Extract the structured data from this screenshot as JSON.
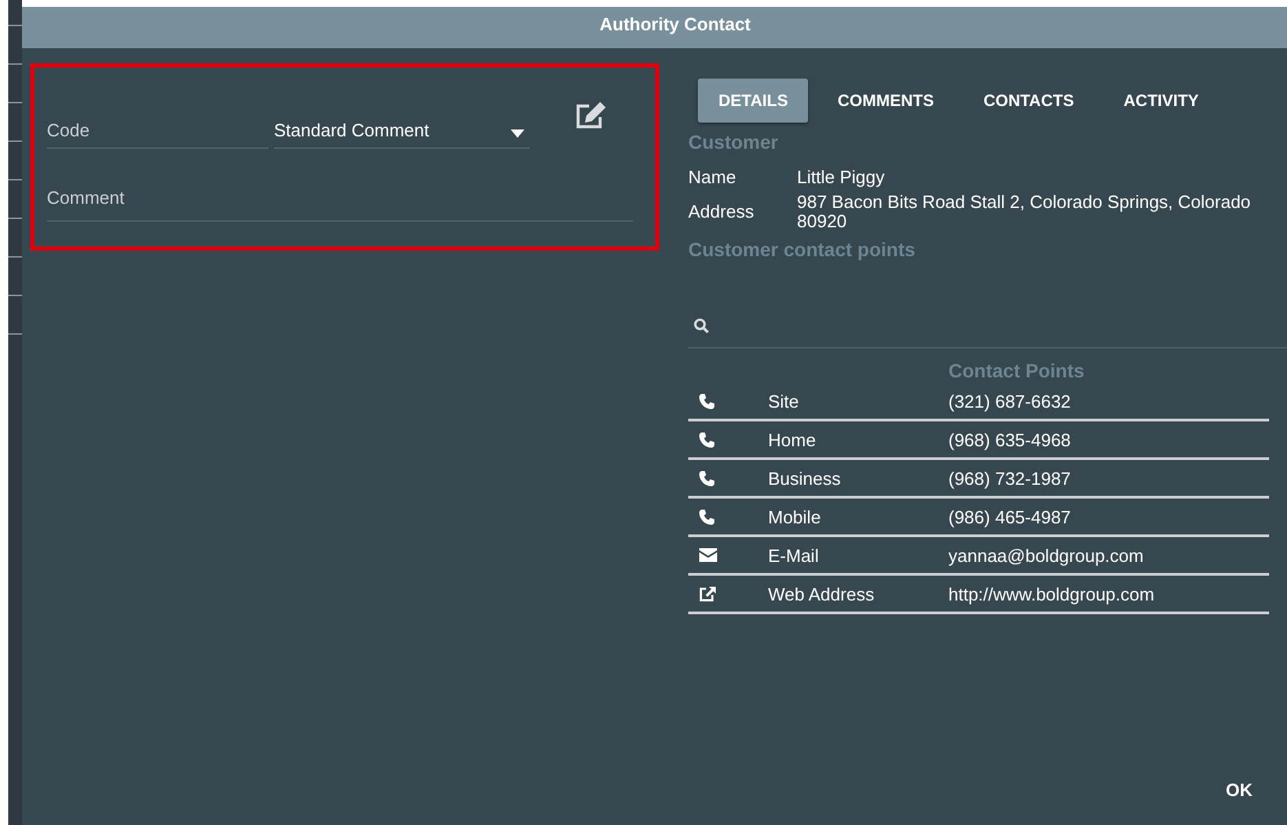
{
  "window": {
    "title": "Authority Contact"
  },
  "form": {
    "code": {
      "label": "Code",
      "value": "Standard Comment"
    },
    "comment": {
      "label": "Comment"
    }
  },
  "tabs": [
    {
      "label": "DETAILS",
      "selected": true
    },
    {
      "label": "COMMENTS",
      "selected": false
    },
    {
      "label": "CONTACTS",
      "selected": false
    },
    {
      "label": "ACTIVITY",
      "selected": false
    }
  ],
  "customer": {
    "heading": "Customer",
    "fields": [
      {
        "label": "Name",
        "value": "Little Piggy"
      },
      {
        "label": "Address",
        "value": "987 Bacon Bits Road Stall 2, Colorado Springs, Colorado 80920"
      }
    ]
  },
  "contact_points": {
    "heading": "Customer contact points",
    "column_header": "Contact Points",
    "rows": [
      {
        "kind": "phone",
        "type": "Site",
        "value": "(321) 687-6632"
      },
      {
        "kind": "phone",
        "type": "Home",
        "value": "(968) 635-4968"
      },
      {
        "kind": "phone",
        "type": "Business",
        "value": "(968) 732-1987"
      },
      {
        "kind": "phone",
        "type": "Mobile",
        "value": "(986) 465-4987"
      },
      {
        "kind": "email",
        "type": "E-Mail",
        "value": "yannaa@boldgroup.com"
      },
      {
        "kind": "web",
        "type": "Web Address",
        "value": "http://www.boldgroup.com"
      }
    ]
  },
  "buttons": [
    "OK"
  ]
}
